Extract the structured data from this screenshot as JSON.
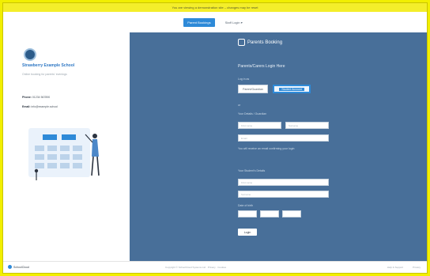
{
  "banner": {
    "text": "You are viewing a demonstration site – changes may be reset"
  },
  "topbar": {
    "primary_label": "Parent Bookings",
    "secondary_label": "Staff Login ▾"
  },
  "school": {
    "name": "Strawberry Example School",
    "subtitle": "Online booking for parents' evenings",
    "phone_label": "Phone:",
    "phone_value": "01234 567890",
    "email_label": "Email:",
    "email_value": "info@example.school"
  },
  "login": {
    "brand": "Parents Booking",
    "title": "Parents/Carers Login Here",
    "step_label": "Log in as",
    "seg_left": "Parent/Guardian",
    "seg_right": "Student Account",
    "or_label": "or",
    "details_label": "Your Details / Guardian",
    "first_name_ph": "First name",
    "surname_ph": "Surname",
    "email_ph": "Email",
    "hint_text": "You will receive an email confirming your login",
    "student_label": "Your Student's Details",
    "student_first_ph": "First name",
    "student_surname_ph": "Surname",
    "dob_label": "Date of birth",
    "login_button": "Login"
  },
  "footer": {
    "logo_text": "SchoolCloud",
    "center_text": "Copyright © SchoolCloud Systems Ltd  ·  Privacy  ·  Cookies",
    "link_help": "Help & Support",
    "link_privacy": "Privacy"
  },
  "colors": {
    "banner": "#f4ee2a",
    "panel": "#486f99",
    "accent": "#2e8ad8",
    "page_outline": "#f2ef00"
  }
}
